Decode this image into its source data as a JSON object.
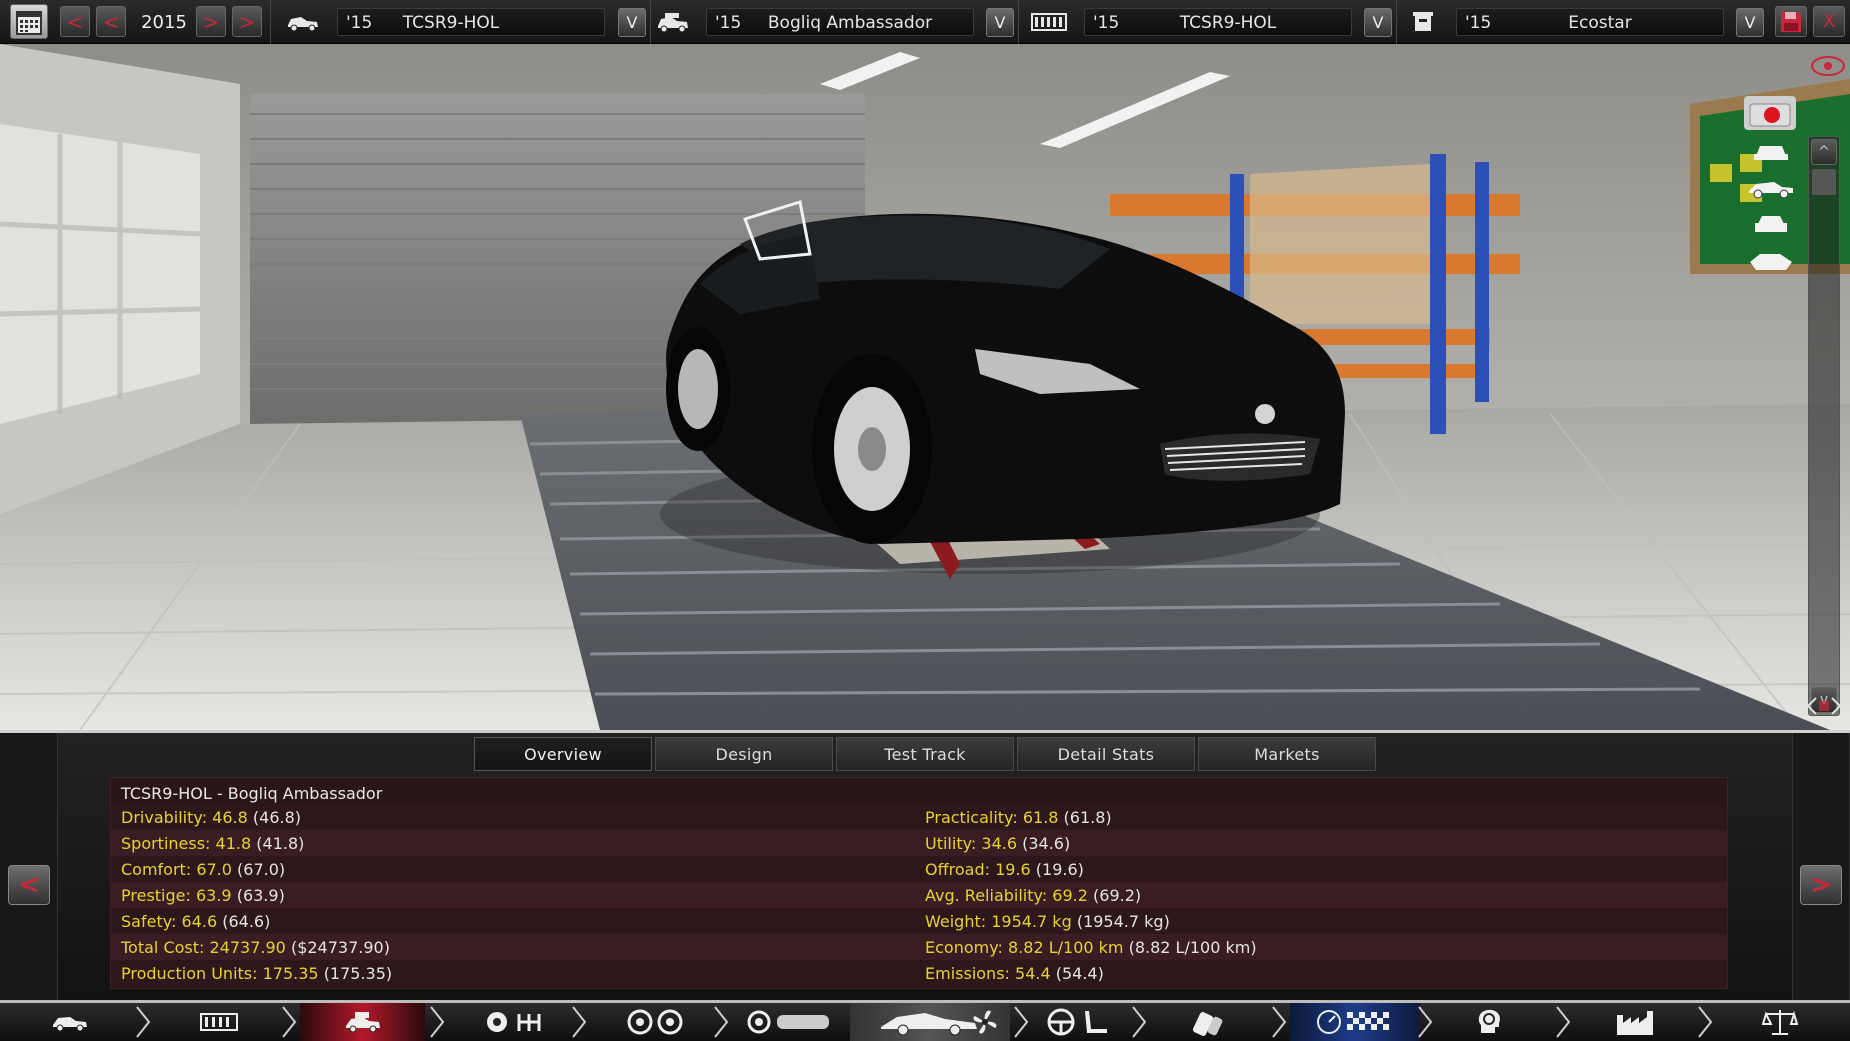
{
  "topbar": {
    "year": "2015",
    "prev_label": "<",
    "prev2_label": "<",
    "next_label": ">",
    "next2_label": ">",
    "selectors": [
      {
        "year": "'15",
        "name": "TCSR9-HOL"
      },
      {
        "year": "'15",
        "name": "Bogliq Ambassador"
      },
      {
        "year": "'15",
        "name": "TCSR9-HOL"
      },
      {
        "year": "'15",
        "name": "Ecostar"
      }
    ],
    "dropdown_label": "V",
    "close_label": "X"
  },
  "viewport": {
    "scroll_up": "^",
    "scroll_down": "v"
  },
  "tabs": [
    "Overview",
    "Design",
    "Test Track",
    "Detail Stats",
    "Markets"
  ],
  "active_tab": "Overview",
  "stats": {
    "title": "TCSR9-HOL - Bogliq Ambassador",
    "left": [
      {
        "key": "Drivability:",
        "val": "46.8",
        "prev": "(46.8)"
      },
      {
        "key": "Sportiness:",
        "val": "41.8",
        "prev": "(41.8)"
      },
      {
        "key": "Comfort:",
        "val": "67.0",
        "prev": "(67.0)"
      },
      {
        "key": "Prestige:",
        "val": "63.9",
        "prev": "(63.9)"
      },
      {
        "key": "Safety:",
        "val": "64.6",
        "prev": "(64.6)"
      },
      {
        "key": "Total Cost:",
        "val": "24737.90",
        "prev": "($24737.90)"
      },
      {
        "key": "Production Units:",
        "val": "175.35",
        "prev": "(175.35)"
      }
    ],
    "right": [
      {
        "key": "Practicality:",
        "val": "61.8",
        "prev": "(61.8)"
      },
      {
        "key": "Utility:",
        "val": "34.6",
        "prev": "(34.6)"
      },
      {
        "key": "Offroad:",
        "val": "19.6",
        "prev": "(19.6)"
      },
      {
        "key": "Avg. Reliability:",
        "val": "69.2",
        "prev": "(69.2)"
      },
      {
        "key": "Weight:",
        "val": "1954.7 kg",
        "prev": "(1954.7 kg)"
      },
      {
        "key": "Economy:",
        "val": "8.82 L/100 km",
        "prev": "(8.82 L/100 km)"
      },
      {
        "key": "Emissions:",
        "val": "54.4",
        "prev": "(54.4)"
      }
    ]
  },
  "nav": {
    "prev_label": "<",
    "next_label": ">"
  },
  "colors": {
    "stat_yellow": "#e6d32e",
    "accent_red": "#c8283a",
    "stats_bg": "#2a1518"
  },
  "bottom_nav_icons": [
    "car-icon",
    "chassis-icon",
    "car-model-icon",
    "engine-gearbox-icon",
    "wheels-icon",
    "body-icon",
    "car-design-icon",
    "fan-icon",
    "interior-icon",
    "fuel-icon",
    "test-track-icon",
    "brain-icon",
    "factory-icon",
    "scales-icon"
  ]
}
